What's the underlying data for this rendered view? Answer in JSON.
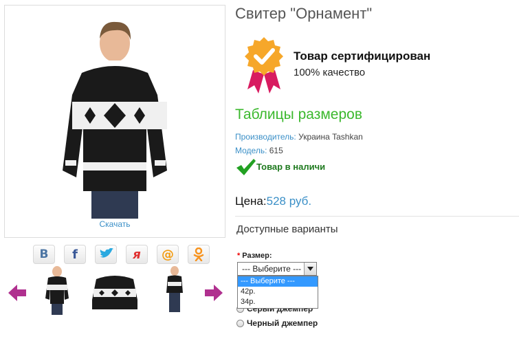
{
  "product": {
    "title": "Свитер \"Орнамент\"",
    "download_label": "Скачать"
  },
  "certificate": {
    "title": "Товар сертифицирован",
    "subtitle": "100% качество"
  },
  "size_table_label": "Таблицы размеров",
  "info": {
    "manufacturer_key": "Производитель:",
    "manufacturer_value": "Украина Tashkan",
    "model_key": "Модель:",
    "model_value": "615",
    "stock": "Товар в наличи"
  },
  "price": {
    "label": "Цена:",
    "value": "528 руб."
  },
  "variants": {
    "title": "Доступные варианты",
    "size_label": "Размер:",
    "required_mark": "*",
    "selected": "--- Выберите ---",
    "options": [
      "--- Выберите ---",
      "42р.",
      "34р."
    ],
    "colors": [
      "Серый джемпер",
      "Черный джемпер"
    ]
  },
  "share": [
    {
      "icon": "vk-icon",
      "glyph": "В",
      "color": "#4c75a3"
    },
    {
      "icon": "facebook-icon",
      "glyph": "f",
      "color": "#3b5998"
    },
    {
      "icon": "twitter-icon",
      "glyph": "🐦",
      "color": "#2aa9e0"
    },
    {
      "icon": "yaru-icon",
      "glyph": "я",
      "color": "#e03030"
    },
    {
      "icon": "mailru-icon",
      "glyph": "@",
      "color": "#f39c12"
    },
    {
      "icon": "odnoklassniki-icon",
      "glyph": "ок",
      "color": "#f7931e"
    }
  ],
  "colors": {
    "link": "#3a8fc7",
    "green": "#3bb82d",
    "stock_green": "#1f7a1f"
  }
}
